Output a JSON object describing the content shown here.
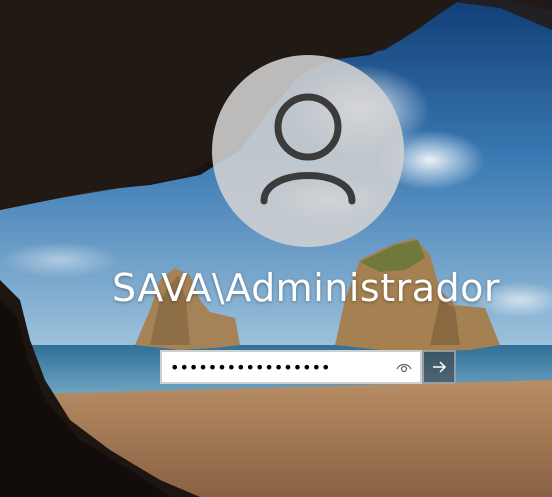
{
  "login": {
    "username": "SAVA\\Administrador",
    "password_masked": "•••••••••••••••••",
    "reveal_icon": "eye-icon",
    "submit_icon": "arrow-right-icon",
    "avatar_icon": "user-icon"
  },
  "colors": {
    "sky_top": "#1b4f8c",
    "sea": "#3e7fae",
    "sand": "#c79a6b",
    "avatar_bg": "#d2d2d2"
  }
}
